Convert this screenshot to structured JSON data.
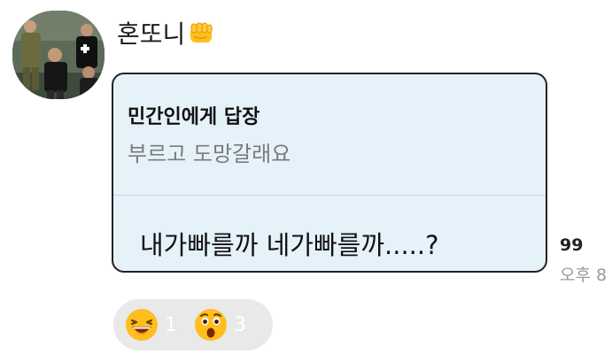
{
  "sender": {
    "name": "혼또니",
    "badge_icon": "fist-emoji-icon"
  },
  "message": {
    "reply_to": {
      "title": "민간인에게 답장",
      "quote": "부르고 도망갈래요"
    },
    "text": "내가빠를까 네가빠를까.....?",
    "unread_count": "99",
    "time": "오후 8"
  },
  "reactions": [
    {
      "icon": "grinning-squint-face-icon",
      "count": "1"
    },
    {
      "icon": "astonished-face-icon",
      "count": "3"
    }
  ],
  "colors": {
    "bubble_background": "#e5f2fa",
    "bubble_border": "#222222",
    "reaction_pill": "#e9e9e9",
    "emoji_yellow": "#ffbe1e"
  }
}
